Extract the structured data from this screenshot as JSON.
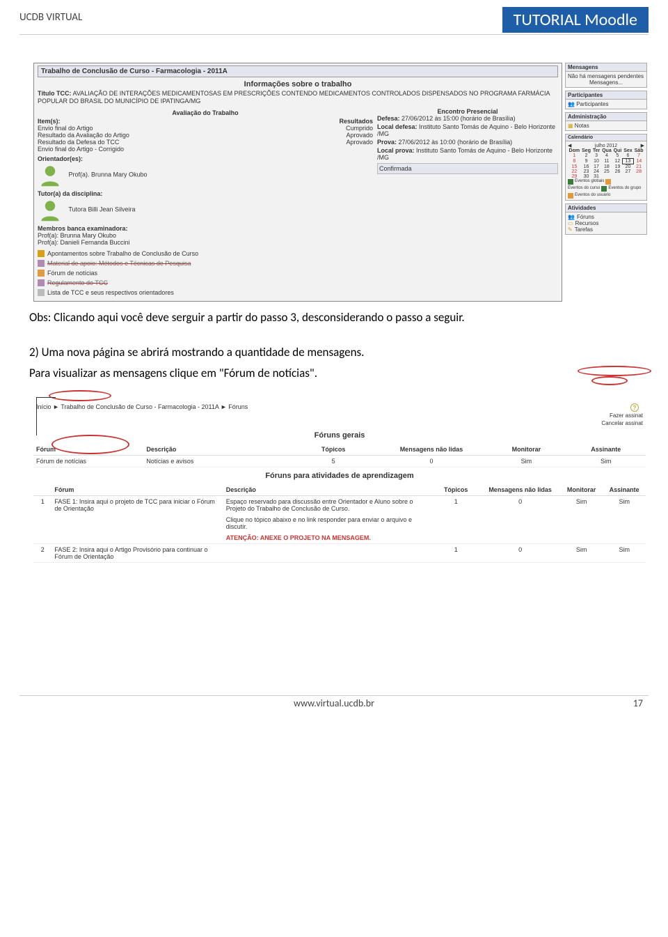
{
  "header": {
    "left": "UCDB VIRTUAL",
    "right": "TUTORIAL Moodle"
  },
  "shot1": {
    "titlebar": "Trabalho de Conclusão de Curso - Farmacologia - 2011A",
    "info_title": "Informações sobre o trabalho",
    "titulo_label": "Título TCC:",
    "titulo_text": "AVALIAÇÃO DE INTERAÇÕES MEDICAMENTOSAS EM PRESCRIÇÕES CONTENDO MEDICAMENTOS CONTROLADOS DISPENSADOS NO PROGRAMA FARMÁCIA POPULAR DO BRASIL DO MUNICÍPIO DE IPATINGA/MG",
    "aval_title": "Avaliação do Trabalho",
    "item_hdr": "Item(s):",
    "res_hdr": "Resultados",
    "items": [
      {
        "name": "Envio final do Artigo",
        "result": "Cumprido"
      },
      {
        "name": "Resultado da Avaliação do Artigo",
        "result": "Aprovado"
      },
      {
        "name": "Resultado da Defesa do TCC",
        "result": "Aprovado"
      },
      {
        "name": "Envio final do Artigo - Corrigido",
        "result": ""
      }
    ],
    "orient_label": "Orientador(es):",
    "orient_name": "Prof(a). Brunna Mary Okubo",
    "tutor_label": "Tutor(a) da disciplina:",
    "tutor_name": "Tutora Billi Jean Silveira",
    "banca_label": "Membros banca examinadora:",
    "banca_1": "Prof(a): Brunna Mary Okubo",
    "banca_2": "Prof(a): Danieli Fernanda Buccini",
    "encontro_title": "Encontro Presencial",
    "defesa_label": "Defesa:",
    "defesa_text": "27/06/2012 às 15:00 (horário de Brasília)",
    "local_def_label": "Local defesa:",
    "local_def_text": "Instituto Santo Tomás de Aquino - Belo Horizonte /MG",
    "prova_label": "Prova:",
    "prova_text": "27/06/2012 às 10:00 (horário de Brasília)",
    "local_prova_label": "Local prova:",
    "local_prova_text": "Instituto Santo Tomás de Aquino - Belo Horizonte /MG",
    "confirmada": "Confirmada",
    "links": [
      {
        "ico": "y",
        "text": "Apontamentos sobre Trabalho de Conclusão de Curso",
        "strike": false
      },
      {
        "ico": "p",
        "text": "Material de apoio: Métodos e Técnicas de Pesquisa",
        "strike": true
      },
      {
        "ico": "o",
        "text": "Fórum de notícias",
        "strike": false
      },
      {
        "ico": "p",
        "text": "Regulamento do TCC",
        "strike": true
      },
      {
        "ico": "g",
        "text": "Lista de TCC e seus respectivos orientadores",
        "strike": false
      }
    ],
    "side": {
      "mensagens_hdr": "Mensagens",
      "mensagens_body": "Não há mensagens pendentes",
      "mensagens_link": "Mensagens...",
      "participantes_hdr": "Participantes",
      "participantes_link": "Participantes",
      "admin_hdr": "Administração",
      "admin_link": "Notas",
      "cal_hdr": "Calendário",
      "cal_month": "julho 2012",
      "cal_days": [
        "Dom",
        "Seg",
        "Ter",
        "Qua",
        "Qui",
        "Sex",
        "Sáb"
      ],
      "cal_weeks": [
        [
          "1",
          "2",
          "3",
          "4",
          "5",
          "6",
          "7"
        ],
        [
          "8",
          "9",
          "10",
          "11",
          "12",
          "13",
          "14"
        ],
        [
          "15",
          "16",
          "17",
          "18",
          "19",
          "20",
          "21"
        ],
        [
          "22",
          "23",
          "24",
          "25",
          "26",
          "27",
          "28"
        ],
        [
          "29",
          "30",
          "31",
          "",
          "",
          "",
          ""
        ]
      ],
      "cal_today": "13",
      "legend": [
        {
          "cls": "g1",
          "txt": "Eventos globais"
        },
        {
          "cls": "g2",
          "txt": "Eventos do curso"
        },
        {
          "cls": "g1",
          "txt": "Eventos do grupo"
        },
        {
          "cls": "g2",
          "txt": "Eventos do usuário"
        }
      ],
      "atv_hdr": "Atividades",
      "atv_links": [
        "Fóruns",
        "Recursos",
        "Tarefas"
      ]
    }
  },
  "obs": "Obs: Clicando aqui você deve serguir a partir do passo 3, desconsiderando o passo a seguir.",
  "step2_a": "2) Uma nova página se abrirá mostrando a quantidade de mensagens.",
  "step2_b": "Para visualizar as mensagens clique em \"Fórum de notícias\".",
  "shot2": {
    "crumb": "Início  ►  Trabalho de Conclusão de Curso - Farmacologia - 2011A  ►  Fóruns",
    "right_tools": [
      "Fazer assinat",
      "Cancelar assinat"
    ],
    "sec1_title": "Fóruns gerais",
    "t1_headers": [
      "Fórum",
      "Descrição",
      "Tópicos",
      "Mensagens não lidas",
      "Monitorar",
      "Assinante"
    ],
    "t1_row": {
      "forum": "Fórum de notícias",
      "desc": "Notícias e avisos",
      "topicos": "5",
      "naolidas": "0",
      "monitorar": "Sim",
      "assinante": "Sim"
    },
    "sec2_title": "Fóruns para atividades de aprendizagem",
    "t2_headers": [
      "",
      "Fórum",
      "Descrição",
      "Tópicos",
      "Mensagens não lidas",
      "Monitorar",
      "Assinante"
    ],
    "t2_rows": [
      {
        "n": "1",
        "forum": "FASE 1: Insira aqui o projeto de TCC para iniciar o Fórum de Orientação",
        "desc_a": "Espaço reservado para discussão entre Orientador e Aluno sobre o Projeto do Trabalho de Conclusão de Curso.",
        "desc_b": "Clique no tópico abaixo e no link responder para enviar o arquivo e discutir.",
        "desc_c": "ATENÇÃO: ANEXE O PROJETO NA MENSAGEM.",
        "topicos": "1",
        "naolidas": "0",
        "monitorar": "Sim",
        "assinante": "Sim"
      },
      {
        "n": "2",
        "forum": "FASE 2: Insira aqui o Artigo Provisório para continuar o Fórum de Orientação",
        "desc_a": "",
        "desc_b": "",
        "desc_c": "",
        "topicos": "1",
        "naolidas": "0",
        "monitorar": "Sim",
        "assinante": "Sim"
      }
    ]
  },
  "footer": {
    "url": "www.virtual.ucdb.br",
    "page": "17"
  }
}
